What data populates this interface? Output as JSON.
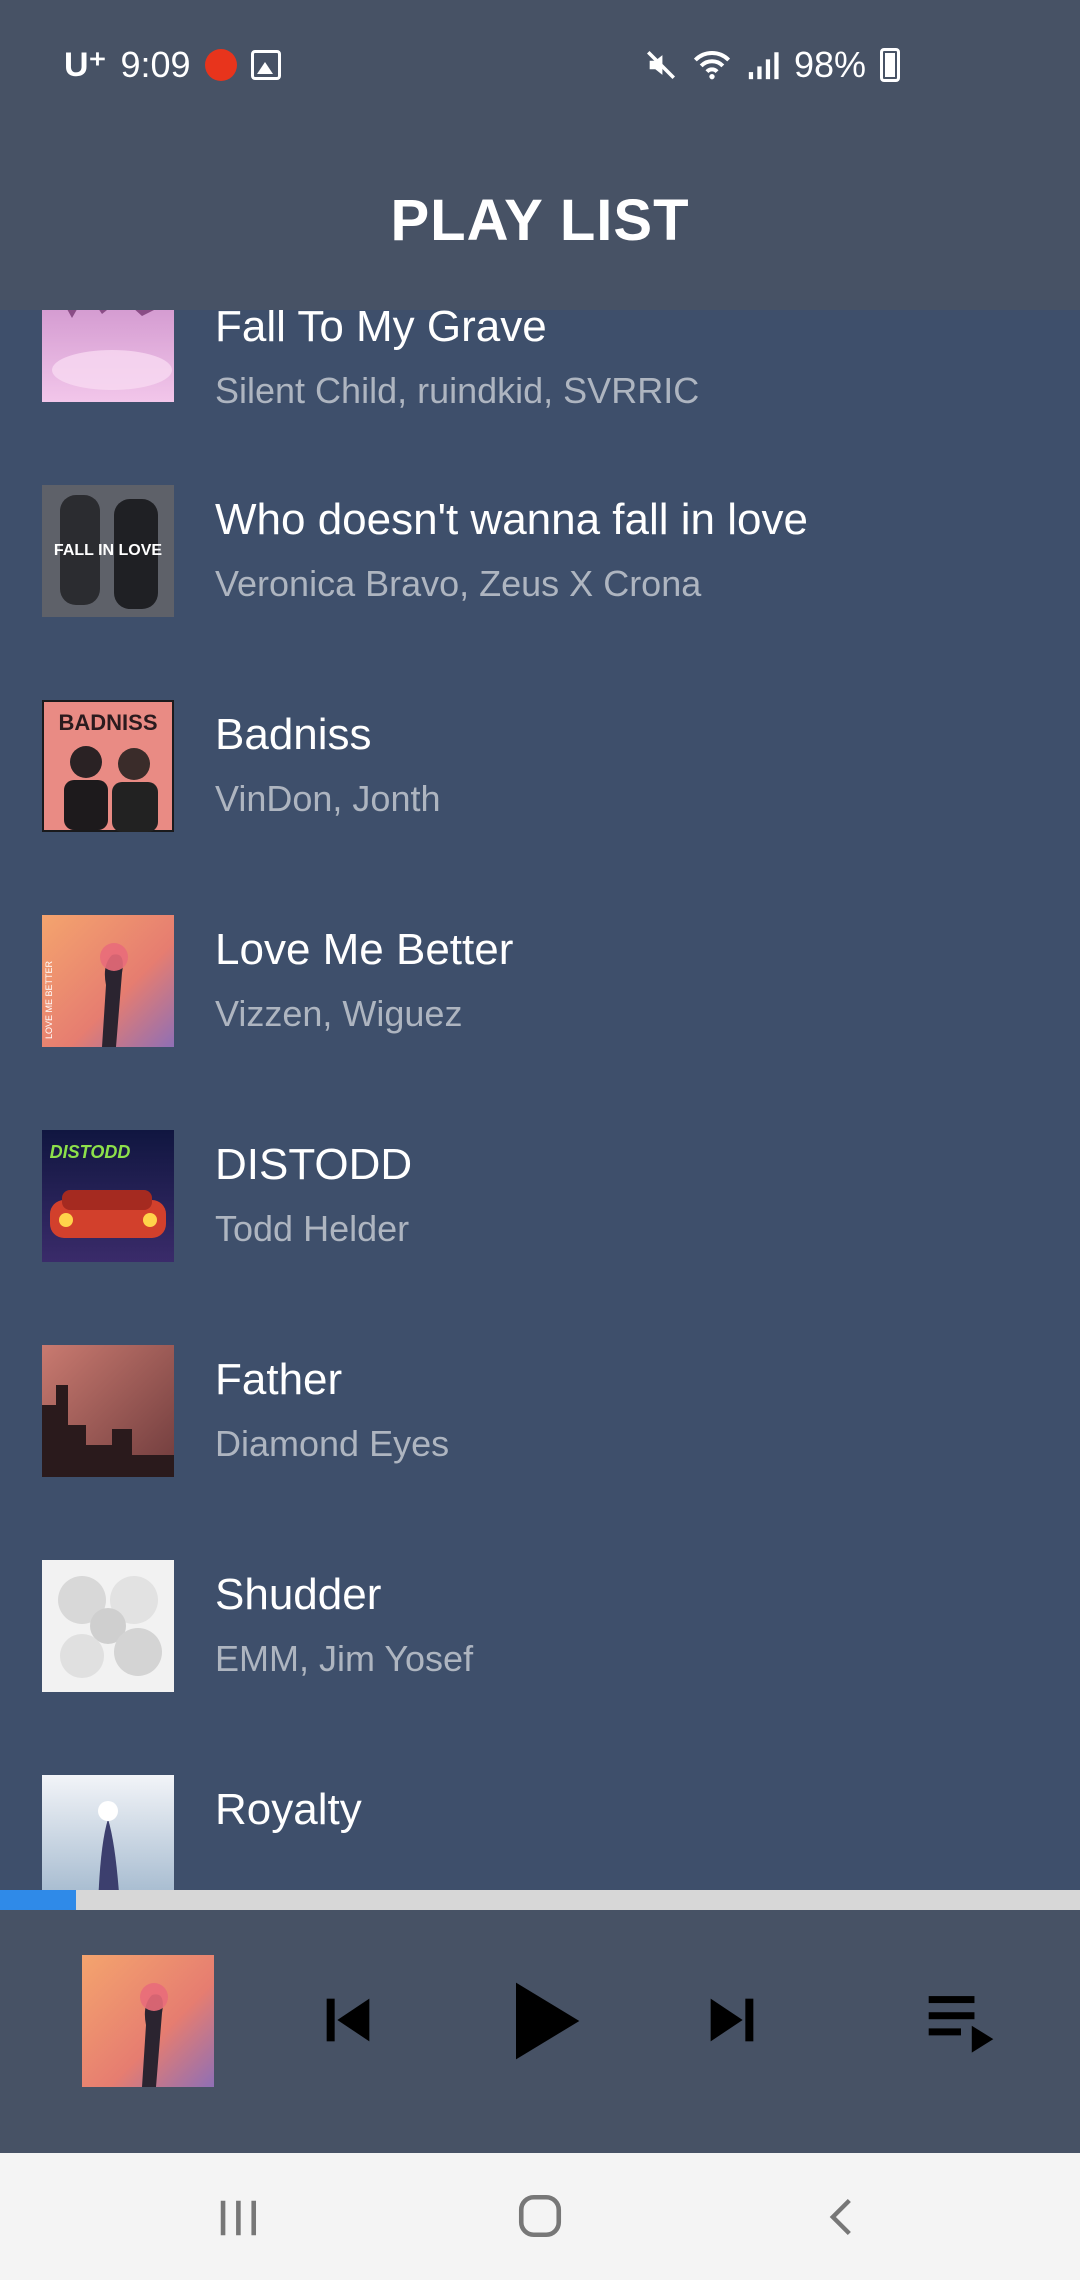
{
  "status_bar": {
    "carrier": "U⁺",
    "time": "9:09",
    "battery": "98%",
    "icons": [
      "record-icon",
      "gallery-icon",
      "mute-icon",
      "wifi-icon",
      "signal-icon",
      "battery-charging-icon"
    ]
  },
  "header": {
    "title": "PLAY LIST"
  },
  "playlist": [
    {
      "title": "Fall To My Grave",
      "artist": "Silent Child, ruindkid, SVRRIC"
    },
    {
      "title": "Who doesn't wanna fall in love",
      "artist": "Veronica Bravo, Zeus X Crona",
      "art_text": "FALL IN LOVE"
    },
    {
      "title": "Badniss",
      "artist": "VinDon, Jonth",
      "art_text": "BADNISS"
    },
    {
      "title": "Love Me Better",
      "artist": "Vizzen, Wiguez",
      "art_text": "LOVE ME BETTER"
    },
    {
      "title": "DISTODD",
      "artist": "Todd Helder",
      "art_text": "DISTODD"
    },
    {
      "title": "Father",
      "artist": "Diamond Eyes"
    },
    {
      "title": "Shudder",
      "artist": "EMM, Jim Yosef"
    },
    {
      "title": "Royalty",
      "artist": ""
    }
  ],
  "progress": {
    "fraction": 0.07,
    "fill_color": "#2f8ae8",
    "track_color": "#d7d7d7"
  },
  "player": {
    "now_playing_art": "Love Me Better",
    "controls": [
      "skip-previous-icon",
      "play-icon",
      "skip-next-icon",
      "queue-music-icon"
    ]
  },
  "navigation": {
    "buttons": [
      "recent-apps-icon",
      "home-icon",
      "back-icon"
    ]
  },
  "colors": {
    "background": "#3e4f6b",
    "bar": "#475265",
    "subtitle": "#aeb5c0"
  }
}
